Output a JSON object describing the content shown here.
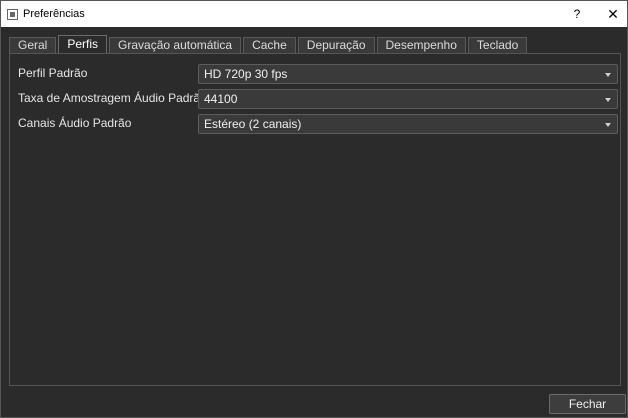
{
  "window": {
    "title": "Preferências",
    "help_label": "?",
    "close_label": "✕"
  },
  "tabs": [
    {
      "label": "Geral",
      "active": false
    },
    {
      "label": "Perfis",
      "active": true
    },
    {
      "label": "Gravação automática",
      "active": false
    },
    {
      "label": "Cache",
      "active": false
    },
    {
      "label": "Depuração",
      "active": false
    },
    {
      "label": "Desempenho",
      "active": false
    },
    {
      "label": "Teclado",
      "active": false
    }
  ],
  "profiles": {
    "rows": [
      {
        "label": "Perfil Padrão",
        "value": "HD 720p 30 fps"
      },
      {
        "label": "Taxa de Amostragem Áudio Padrão",
        "value": "44100"
      },
      {
        "label": "Canais Áudio Padrão",
        "value": "Estéreo (2 canais)"
      }
    ]
  },
  "footer": {
    "close_button_label": "Fechar"
  }
}
